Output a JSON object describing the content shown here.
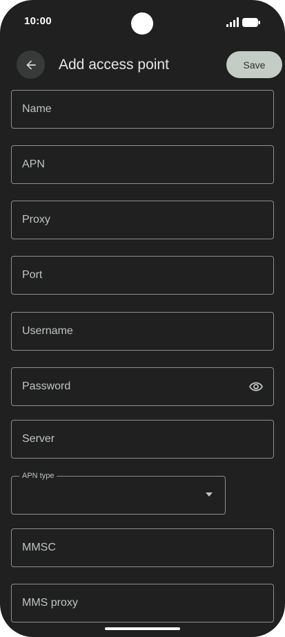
{
  "status_bar": {
    "time": "10:00"
  },
  "app_bar": {
    "title": "Add access point",
    "save_label": "Save"
  },
  "fields": {
    "name": "Name",
    "apn": "APN",
    "proxy": "Proxy",
    "port": "Port",
    "username": "Username",
    "password": "Password",
    "server": "Server",
    "apn_type": "APN type",
    "mmsc": "MMSC",
    "mms_proxy": "MMS proxy"
  },
  "icons": {
    "back": "arrow-back-icon",
    "visibility": "eye-icon",
    "dropdown": "caret-down-icon",
    "signal": "signal-icon",
    "battery": "battery-icon"
  },
  "colors": {
    "background": "#1f201f",
    "save_button": "#c4ccc6",
    "field_border": "#8c918e",
    "placeholder": "#c0c5c2",
    "title": "#e6e7e5"
  }
}
